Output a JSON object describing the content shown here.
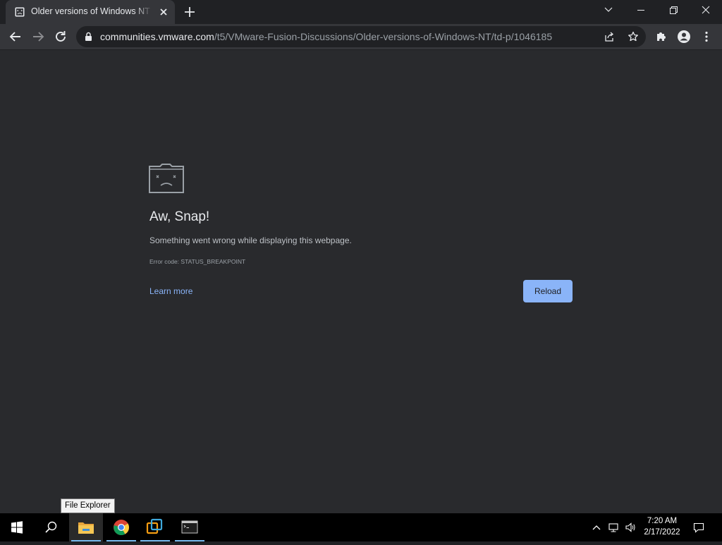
{
  "browser": {
    "tab": {
      "title": "Older versions of Windows NT - VMware"
    },
    "address": {
      "host": "communities.vmware.com",
      "path": "/t5/VMware-Fusion-Discussions/Older-versions-of-Windows-NT/td-p/1046185"
    }
  },
  "error_page": {
    "title": "Aw, Snap!",
    "message": "Something went wrong while displaying this webpage.",
    "error_code": "Error code: STATUS_BREAKPOINT",
    "learn_more": "Learn more",
    "reload": "Reload"
  },
  "tooltip": "File Explorer",
  "taskbar": {
    "items": [
      "start-icon",
      "search-icon",
      "file-explorer-icon",
      "chrome-icon",
      "vmware-icon",
      "terminal-icon"
    ],
    "tray": [
      "chevron-up-icon",
      "network-icon",
      "volume-icon",
      "notifications-icon"
    ],
    "clock": {
      "time": "7:20 AM",
      "date": "2/17/2022"
    }
  },
  "colors": {
    "accent": "#8ab4f8",
    "page_bg": "#292a2d",
    "chrome_frame": "#202124",
    "toolbar": "#35363a"
  }
}
